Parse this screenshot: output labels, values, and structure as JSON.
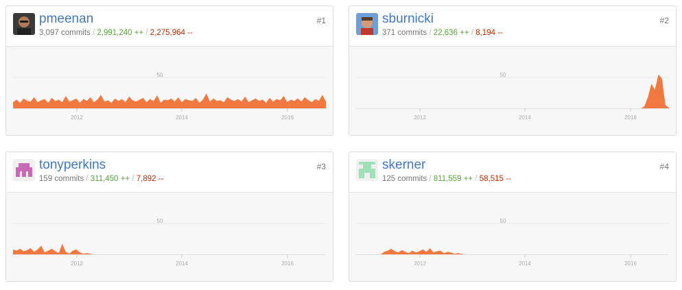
{
  "contributors": [
    {
      "username": "pmeenan",
      "commits_text": "3,097 commits",
      "additions_text": "2,991,240 ++",
      "deletions_text": "2,275,964 --",
      "rank": "#1",
      "avatar": "photo-avatar",
      "chart_data": {
        "type": "area",
        "y_gridline_label": "50",
        "x_tick_labels": [
          "2012",
          "2014",
          "2016"
        ],
        "ylim": [
          0,
          100
        ],
        "color": "#f1793f",
        "activity": "steady weekly activity ~8-22 commits from start through 2016",
        "values": [
          10,
          14,
          9,
          16,
          12,
          11,
          18,
          10,
          13,
          15,
          9,
          17,
          12,
          14,
          10,
          20,
          11,
          13,
          16,
          9,
          15,
          12,
          18,
          10,
          14,
          22,
          11,
          13,
          9,
          16,
          12,
          15,
          10,
          19,
          13,
          11,
          14,
          17,
          10,
          15,
          12,
          21,
          9,
          14,
          13,
          16,
          11,
          18,
          10,
          15,
          13,
          12,
          17,
          9,
          14,
          24,
          11,
          16,
          12,
          13,
          10,
          18,
          14,
          12,
          15,
          11,
          19,
          10,
          13,
          16,
          12,
          14,
          9,
          17,
          11,
          15,
          13,
          20,
          10,
          14,
          12,
          16,
          11,
          18,
          13,
          10,
          15,
          12,
          22,
          11
        ]
      }
    },
    {
      "username": "sburnicki",
      "commits_text": "371 commits",
      "additions_text": "22,636 ++",
      "deletions_text": "8,194 --",
      "rank": "#2",
      "avatar": "photo-avatar",
      "chart_data": {
        "type": "area",
        "y_gridline_label": "50",
        "x_tick_labels": [
          "2012",
          "2014",
          "2016"
        ],
        "ylim": [
          0,
          100
        ],
        "color": "#f1793f",
        "activity": "no activity until late 2016, then a burst peaking ~55",
        "values": [
          0,
          0,
          0,
          0,
          0,
          0,
          0,
          0,
          0,
          0,
          0,
          0,
          0,
          0,
          0,
          0,
          0,
          0,
          0,
          0,
          0,
          0,
          0,
          0,
          0,
          0,
          0,
          0,
          0,
          0,
          0,
          0,
          0,
          0,
          0,
          0,
          0,
          0,
          0,
          0,
          0,
          0,
          0,
          0,
          0,
          0,
          0,
          0,
          0,
          0,
          0,
          0,
          0,
          0,
          0,
          0,
          0,
          0,
          0,
          0,
          0,
          0,
          0,
          0,
          0,
          0,
          0,
          0,
          0,
          0,
          0,
          0,
          0,
          0,
          0,
          0,
          0,
          0,
          0,
          0,
          0,
          0,
          3,
          18,
          40,
          30,
          55,
          48,
          5,
          1
        ]
      }
    },
    {
      "username": "tonyperkins",
      "commits_text": "159 commits",
      "additions_text": "311,450 ++",
      "deletions_text": "7,892 --",
      "rank": "#3",
      "avatar": "identicon-pink",
      "chart_data": {
        "type": "area",
        "y_gridline_label": "50",
        "x_tick_labels": [
          "2012",
          "2014",
          "2016"
        ],
        "ylim": [
          0,
          100
        ],
        "color": "#f1793f",
        "activity": "small activity 2011-2012 only",
        "values": [
          8,
          6,
          9,
          5,
          7,
          10,
          4,
          8,
          14,
          3,
          6,
          9,
          5,
          2,
          17,
          4,
          1,
          6,
          8,
          3,
          1,
          2,
          1,
          0,
          0,
          0,
          0,
          0,
          0,
          0,
          0,
          0,
          0,
          0,
          0,
          0,
          0,
          0,
          0,
          0,
          0,
          0,
          0,
          0,
          0,
          0,
          0,
          0,
          0,
          0,
          0,
          0,
          0,
          0,
          0,
          0,
          0,
          0,
          0,
          0,
          0,
          0,
          0,
          0,
          0,
          0,
          0,
          0,
          0,
          0,
          0,
          0,
          0,
          0,
          0,
          0,
          0,
          0,
          0,
          0,
          0,
          0,
          0,
          0,
          0,
          0,
          0,
          0,
          0,
          0
        ]
      }
    },
    {
      "username": "skerner",
      "commits_text": "125 commits",
      "additions_text": "811,559 ++",
      "deletions_text": "58,515 --",
      "rank": "#4",
      "avatar": "identicon-green",
      "chart_data": {
        "type": "area",
        "y_gridline_label": "50",
        "x_tick_labels": [
          "2012",
          "2014",
          "2016"
        ],
        "ylim": [
          0,
          100
        ],
        "color": "#f1793f",
        "activity": "small activity 2011-2013 only",
        "values": [
          0,
          0,
          0,
          0,
          0,
          0,
          0,
          0,
          4,
          6,
          9,
          5,
          3,
          7,
          4,
          2,
          6,
          3,
          5,
          8,
          4,
          10,
          3,
          5,
          6,
          2,
          4,
          3,
          1,
          2,
          1,
          0,
          0,
          0,
          0,
          0,
          0,
          0,
          0,
          0,
          0,
          0,
          0,
          0,
          0,
          0,
          0,
          0,
          0,
          0,
          0,
          0,
          0,
          0,
          0,
          0,
          0,
          0,
          0,
          0,
          0,
          0,
          0,
          0,
          0,
          0,
          0,
          0,
          0,
          0,
          0,
          0,
          0,
          0,
          0,
          0,
          0,
          0,
          0,
          0,
          0,
          0,
          0,
          0,
          0,
          0,
          0,
          0,
          0,
          0
        ]
      }
    }
  ],
  "separator": "/"
}
